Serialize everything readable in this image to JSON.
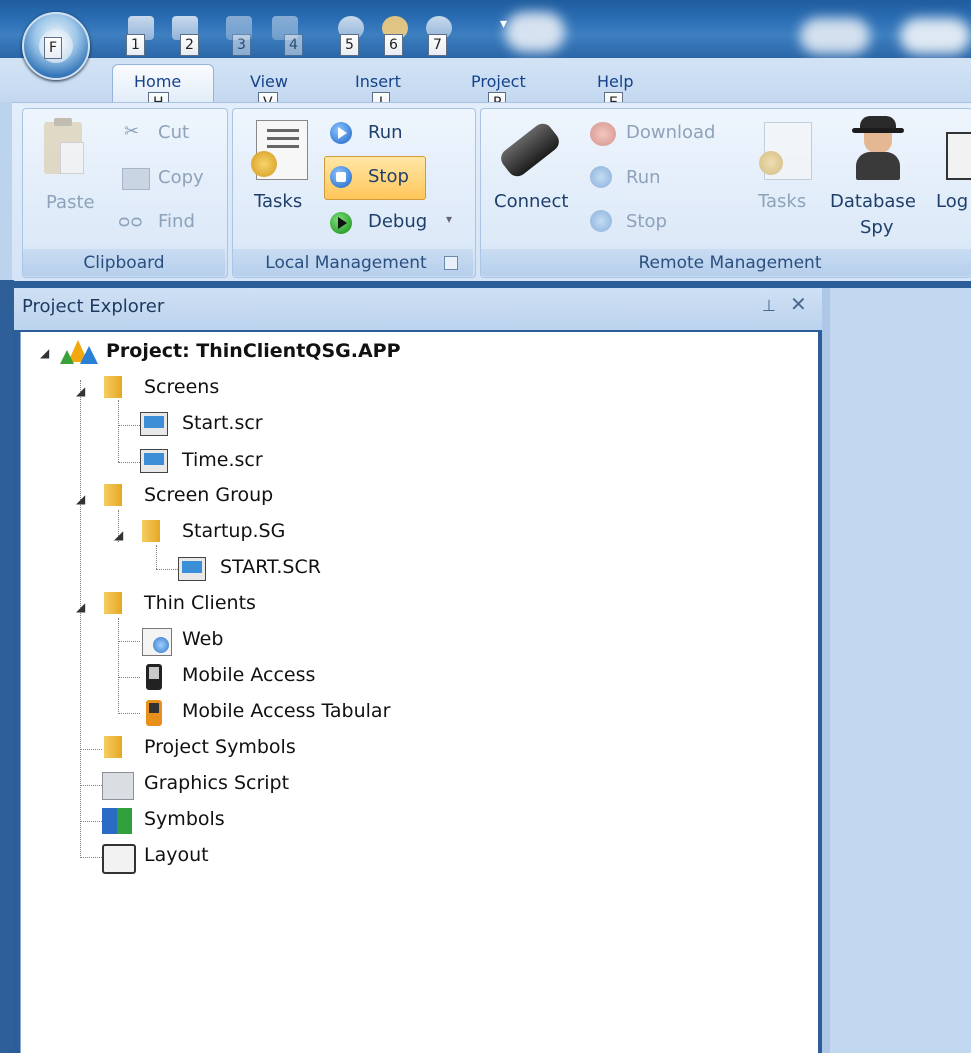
{
  "quick_access": {
    "orb_key": "F",
    "keytips": [
      "1",
      "2",
      "3",
      "4",
      "5",
      "6",
      "7"
    ]
  },
  "tabs": [
    {
      "label": "Home",
      "key": "H"
    },
    {
      "label": "View",
      "key": "V"
    },
    {
      "label": "Insert",
      "key": "I"
    },
    {
      "label": "Project",
      "key": "P"
    },
    {
      "label": "Help",
      "key": "E"
    }
  ],
  "clipboard": {
    "paste": "Paste",
    "cut": "Cut",
    "copy": "Copy",
    "find": "Find",
    "group": "Clipboard"
  },
  "local": {
    "tasks": "Tasks",
    "run": "Run",
    "stop": "Stop",
    "debug": "Debug",
    "group": "Local Management"
  },
  "remote": {
    "connect": "Connect",
    "download": "Download",
    "run": "Run",
    "stop": "Stop",
    "tasks": "Tasks",
    "database_spy_1": "Database",
    "database_spy_2": "Spy",
    "log": "Log",
    "group": "Remote Management"
  },
  "explorer": {
    "title": "Project Explorer",
    "pin": "⊥",
    "close": "✕",
    "project": "Project: ThinClientQSG.APP",
    "screens": "Screens",
    "start_scr": "Start.scr",
    "time_scr": "Time.scr",
    "screen_group": "Screen Group",
    "startup_sg": "Startup.SG",
    "start_scr_upper": "START.SCR",
    "thin_clients": "Thin Clients",
    "web": "Web",
    "mobile_access": "Mobile Access",
    "mobile_access_tabular": "Mobile Access Tabular",
    "project_symbols": "Project Symbols",
    "graphics_script": "Graphics Script",
    "symbols": "Symbols",
    "layout": "Layout"
  },
  "colors": {
    "accent": "#15428b",
    "stop_highlight": "#ffd27a",
    "ribbon": "#d4e4f6"
  }
}
